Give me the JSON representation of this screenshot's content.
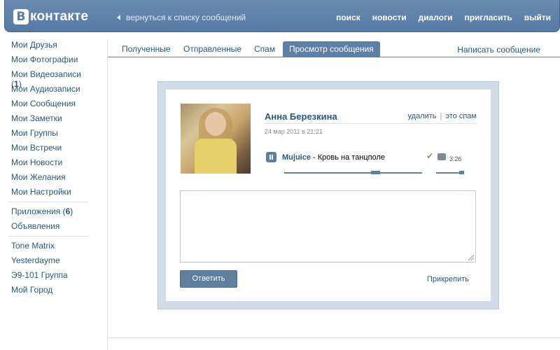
{
  "header": {
    "logo_letter": "В",
    "logo_text": "контакте",
    "back_link": "вернуться к списку сообщений",
    "nav": [
      "поиск",
      "новости",
      "диалоги",
      "пригласить",
      "выйти"
    ]
  },
  "sidebar": {
    "items": [
      {
        "label": "Мои Друзья"
      },
      {
        "label": "Мои Фотографии"
      },
      {
        "label": "Мои Видеозаписи",
        "count": "1"
      },
      {
        "label": "Мои Аудиозаписи"
      },
      {
        "label": "Мои Сообщения"
      },
      {
        "label": "Мои Заметки"
      },
      {
        "label": "Мои Группы"
      },
      {
        "label": "Мои Встречи"
      },
      {
        "label": "Мои Новости"
      },
      {
        "label": "Мои Желания"
      },
      {
        "label": "Мои Настройки"
      }
    ],
    "apps": [
      {
        "label": "Приложения",
        "count": "6"
      },
      {
        "label": "Объявления"
      }
    ],
    "bookmarks": [
      "Tone Matrix",
      "Yesterdayme",
      "Э9-101 Группа",
      "Мой Город"
    ]
  },
  "tabs": {
    "items": [
      "Полученные",
      "Отправленные",
      "Спам",
      "Просмотр сообщения"
    ],
    "active_index": 3,
    "write_link": "Написать сообщение"
  },
  "message": {
    "author": "Анна Березкина",
    "delete_link": "удалить",
    "spam_link": "это спам",
    "date": "24 мар 2011 в 21:21",
    "audio": {
      "artist": "Mujuice",
      "separator": " - ",
      "title": "Кровь на танцполе",
      "duration": "3:26",
      "progress": 0.66,
      "volume": 0.9
    }
  },
  "reply": {
    "value": "",
    "button_label": "Ответить",
    "attach_label": "Прикрепить"
  },
  "colors": {
    "header": "#557ba5",
    "link": "#2b587a",
    "active_tab": "#5b7fa6",
    "frame": "#d2dce6"
  }
}
